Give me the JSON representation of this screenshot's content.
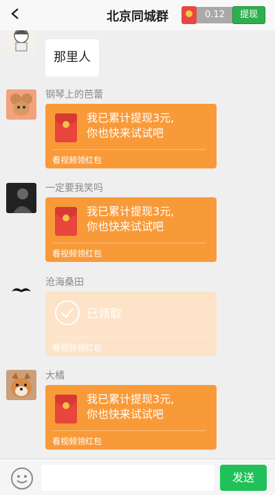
{
  "header": {
    "title": "北京同城群",
    "balance": "0.12",
    "withdraw_label": "提现"
  },
  "messages": [
    {
      "sender": "",
      "text": "那里人"
    },
    {
      "sender": "钢琴上的芭蕾",
      "text_line1": "我已累计提现3元,",
      "text_line2": "你也快来试试吧",
      "footer": "看视频领红包"
    },
    {
      "sender": "一定要我笑吗",
      "text_line1": "我已累计提现3元,",
      "text_line2": "你也快来试试吧",
      "footer": "看视频领红包"
    },
    {
      "sender": "沧海桑田",
      "text": "已领取",
      "footer": "看视频领红包"
    },
    {
      "sender": "大橘",
      "text_line1": "我已累计提现3元,",
      "text_line2": "你也快来试试吧",
      "footer": "看视频领红包"
    }
  ],
  "input": {
    "placeholder": "",
    "send_label": "发送"
  },
  "colors": {
    "red_packet": "#f99a39",
    "red_packet_claimed": "#fde3c8",
    "send_button": "#21c15a"
  }
}
